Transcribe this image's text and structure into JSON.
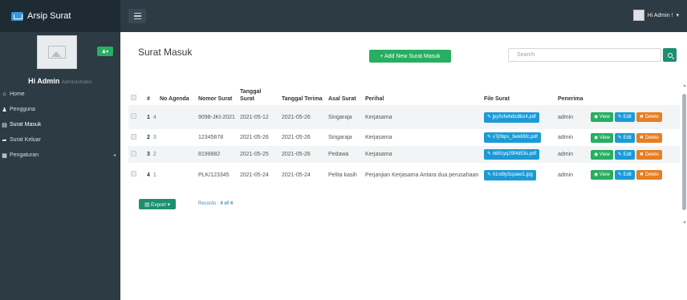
{
  "app": {
    "title": "Arsip Surat"
  },
  "header": {
    "greeting": "Hi Admin !",
    "caret": "▾"
  },
  "profile": {
    "name": "Hi Admin",
    "role": "Administrator",
    "button_icon": "user-icon"
  },
  "sidebar": {
    "items": [
      {
        "label": "Home",
        "icon": "home-icon",
        "glyph": "⌂"
      },
      {
        "label": "Pengguna",
        "icon": "users-icon",
        "glyph": "♟"
      },
      {
        "label": "Surat Masuk",
        "icon": "inbox-icon",
        "glyph": "▤",
        "active": true
      },
      {
        "label": "Surat Keluar",
        "icon": "share-icon",
        "glyph": "➦"
      },
      {
        "label": "Pengaturan",
        "icon": "settings-icon",
        "glyph": "▦"
      }
    ]
  },
  "page": {
    "title": "Surat Masuk",
    "add_button": "+ Add New Surat Masuk"
  },
  "search": {
    "placeholder": "Search"
  },
  "table": {
    "headers": {
      "no": "#",
      "agenda": "No Agenda",
      "nomor": "Nomor Surat",
      "tgl_surat": "Tanggal Surat",
      "tgl_terima": "Tanggal Terima",
      "asal": "Asal Surat",
      "perihal": "Perihal",
      "file": "File Surat",
      "penerima": "Penerima"
    },
    "rows": [
      {
        "no": "1",
        "agenda": "4",
        "nomor": "9098-JKt-2021",
        "tgl_surat": "2021-05-12",
        "tgl_terima": "2021-05-26",
        "asal": "Singaraja",
        "perihal": "Kerjasama",
        "file": "jpy5cfwhdlc8bz4.pdf",
        "penerima": "admin"
      },
      {
        "no": "2",
        "agenda": "3",
        "nomor": "12345678",
        "tgl_surat": "2021-05-26",
        "tgl_terima": "2021-05-26",
        "asal": "Singaraja",
        "perihal": "Kerjasama",
        "file": "v7j0bps_3wk65fc.pdf",
        "penerima": "admin"
      },
      {
        "no": "3",
        "agenda": "2",
        "nomor": "8199882",
        "tgl_surat": "2021-05-25",
        "tgl_terima": "2021-05-26",
        "asal": "Pedawa",
        "perihal": "Kerjasama",
        "file": "n681yq29f4d53s.pdf",
        "penerima": "admin"
      },
      {
        "no": "4",
        "agenda": "1",
        "nomor": "PLK/123345",
        "tgl_surat": "2021-05-24",
        "tgl_terima": "2021-05-24",
        "asal": "Pelita kasih",
        "perihal": "Perjanjian Kerjasama Antara dua perusahaan",
        "file": "h1rd8y3cpawi1.jpg",
        "penerima": "admin"
      }
    ],
    "actions": {
      "view": "◉ View",
      "edit": "✎ Edit",
      "delete": "✖ Delete"
    }
  },
  "footer": {
    "export": "Export ▾",
    "records_label": "Records :",
    "records_value": "4 of 4"
  }
}
